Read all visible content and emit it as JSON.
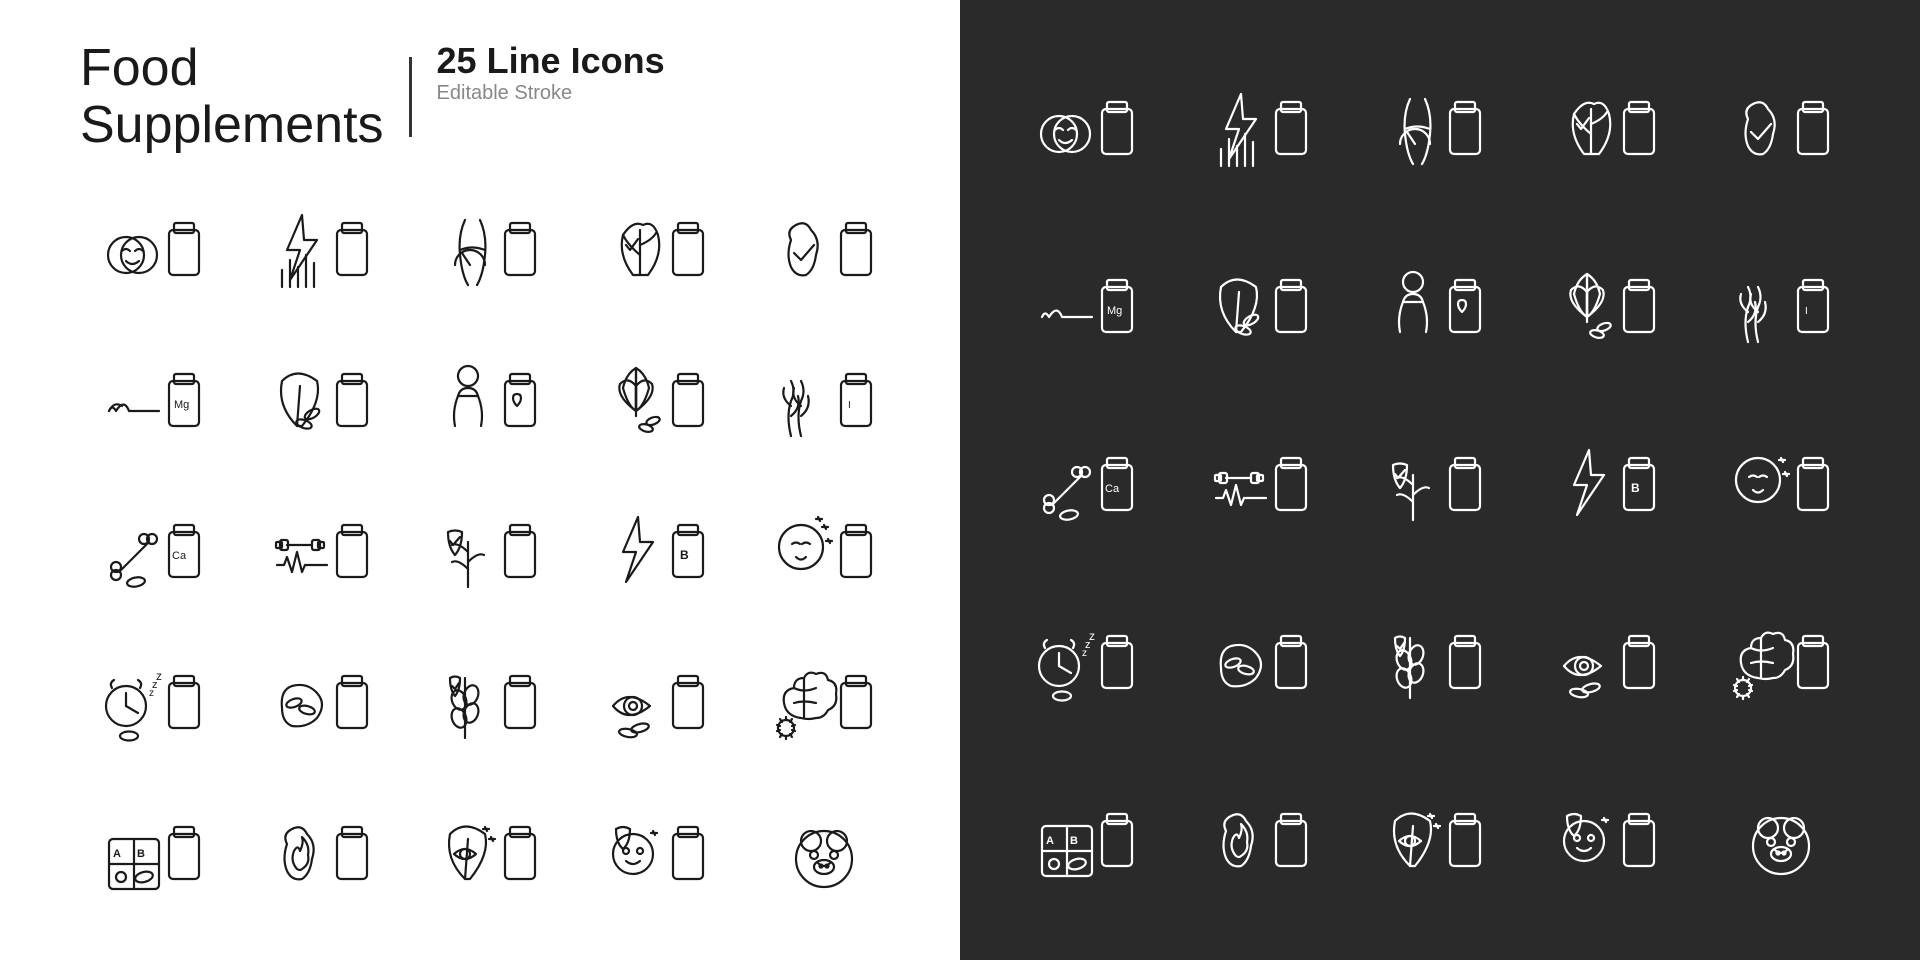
{
  "header": {
    "title_line1": "Food",
    "title_line2": "Supplements",
    "line_count": "25 Line",
    "icon_type": "Icons",
    "editable": "Editable Stroke"
  },
  "icons": [
    {
      "id": "beauty-supplement",
      "label": "beauty supplement"
    },
    {
      "id": "energy-supplement",
      "label": "energy supplement"
    },
    {
      "id": "weight-supplement",
      "label": "weight supplement"
    },
    {
      "id": "immune-supplement",
      "label": "immune supplement"
    },
    {
      "id": "digestive-supplement",
      "label": "digestive supplement"
    },
    {
      "id": "magnesium-supplement",
      "label": "magnesium supplement"
    },
    {
      "id": "herbal-supplement",
      "label": "herbal supplement"
    },
    {
      "id": "womens-supplement",
      "label": "womens supplement"
    },
    {
      "id": "lotus-supplement",
      "label": "lotus supplement"
    },
    {
      "id": "iodine-supplement",
      "label": "iodine supplement"
    },
    {
      "id": "calcium-supplement",
      "label": "calcium supplement"
    },
    {
      "id": "sport-supplement",
      "label": "sport supplement"
    },
    {
      "id": "plant-immune",
      "label": "plant immune"
    },
    {
      "id": "vitamin-b",
      "label": "vitamin b"
    },
    {
      "id": "beauty-skin",
      "label": "beauty skin"
    },
    {
      "id": "sleep-supplement",
      "label": "sleep supplement"
    },
    {
      "id": "liver-supplement",
      "label": "liver supplement"
    },
    {
      "id": "wheat-supplement",
      "label": "wheat supplement"
    },
    {
      "id": "eye-supplement",
      "label": "eye supplement"
    },
    {
      "id": "brain-supplement",
      "label": "brain supplement"
    },
    {
      "id": "vitamin-ab",
      "label": "vitamin ab"
    },
    {
      "id": "digestive-fire",
      "label": "digestive fire"
    },
    {
      "id": "eye-drop",
      "label": "eye drop"
    },
    {
      "id": "kids-supplement",
      "label": "kids supplement"
    },
    {
      "id": "bear-supplement",
      "label": "bear supplement"
    }
  ]
}
